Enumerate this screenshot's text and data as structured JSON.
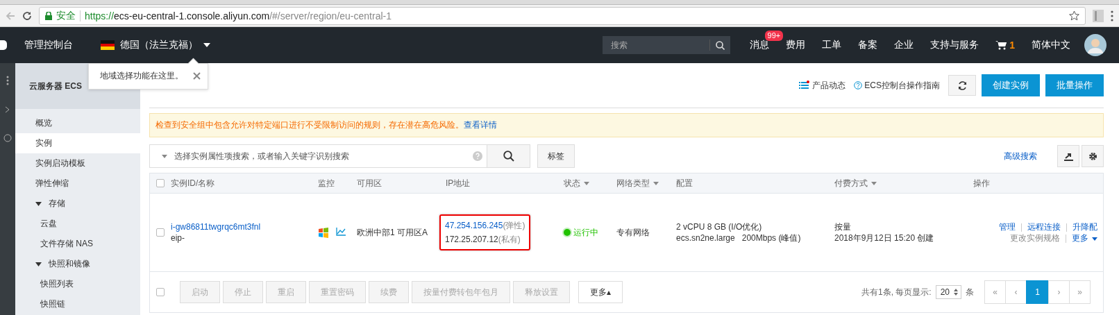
{
  "browser": {
    "secure_label": "安全",
    "url_scheme": "https://",
    "url_host": "ecs-eu-central-1.console.aliyun.com",
    "url_path": "/#/server/region/eu-central-1"
  },
  "topbar": {
    "console": "管理控制台",
    "region": "德国（法兰克福）",
    "search_placeholder": "搜索",
    "nav": [
      {
        "label": "消息",
        "badge": "99+"
      },
      {
        "label": "费用"
      },
      {
        "label": "工单"
      },
      {
        "label": "备案"
      },
      {
        "label": "企业"
      },
      {
        "label": "支持与服务"
      }
    ],
    "cart_count": "1",
    "language": "简体中文"
  },
  "tooltip": {
    "text": "地域选择功能在这里。"
  },
  "sidebar": {
    "title": "云服务器 ECS",
    "items": [
      {
        "label": "概览",
        "selected": false
      },
      {
        "label": "实例",
        "selected": true
      },
      {
        "label": "实例启动模板",
        "selected": false
      },
      {
        "label": "弹性伸缩",
        "selected": false
      },
      {
        "label": "存储",
        "selected": false,
        "expanded": true,
        "children": [
          {
            "label": "云盘",
            "selected": false
          },
          {
            "label": "文件存储 NAS",
            "selected": false
          }
        ]
      },
      {
        "label": "快照和镜像",
        "selected": false,
        "expanded": true,
        "children": [
          {
            "label": "快照列表",
            "selected": false
          },
          {
            "label": "快照链",
            "selected": false
          }
        ]
      }
    ]
  },
  "header_links": [
    {
      "kind": "news",
      "label": "产品动态",
      "unread": true
    },
    {
      "kind": "help",
      "label": "ECS控制台操作指南"
    }
  ],
  "header_buttons": [
    "创建实例",
    "批量操作"
  ],
  "alert": {
    "text": "检查到安全组中包含允许对特定端口进行不受限制访问的规则，存在潜在高危风险。",
    "link": "查看详情"
  },
  "filter": {
    "placeholder": "选择实例属性项搜索，或者输入关键字识别搜索",
    "tag_button": "标签",
    "advanced_search": "高级搜索"
  },
  "table": {
    "checked": false,
    "columns": [
      {
        "label": "实例ID/名称",
        "sortable": false
      },
      {
        "label": "监控",
        "sortable": false
      },
      {
        "label": "可用区",
        "sortable": false
      },
      {
        "label": "IP地址",
        "sortable": false
      },
      {
        "label": "状态",
        "sortable": true
      },
      {
        "label": "网络类型",
        "sortable": true
      },
      {
        "label": "配置",
        "sortable": false
      },
      {
        "label": "付费方式",
        "sortable": true
      },
      {
        "label": "操作",
        "sortable": false
      }
    ],
    "rows": [
      {
        "checked": false,
        "id": "i-gw86811twgrqc6mt3fnl",
        "name": "eip-",
        "zone": "欧洲中部1 可用区A",
        "ip_public": "47.254.156.245",
        "ip_public_tag": "(弹性)",
        "ip_private": "172.25.207.12",
        "ip_private_tag": "(私有)",
        "ip_highlighted": true,
        "status": "运行中",
        "network": "专有网络",
        "config_lines": [
          "2 vCPU 8 GB (I/O优化)",
          "ecs.sn2ne.large   200Mbps (峰值)"
        ],
        "billing": "按量",
        "created": "2018年9月12日 15:20 创建",
        "actions": [
          {
            "label": "管理",
            "disabled": false
          },
          {
            "label": "远程连接",
            "disabled": false
          },
          {
            "label": "升降配",
            "disabled": false
          },
          {
            "label": "更改实例规格",
            "disabled": true
          },
          {
            "label": "更多",
            "disabled": false
          }
        ]
      }
    ]
  },
  "footer": {
    "checked": false,
    "buttons": [
      {
        "label": "启动",
        "disabled": true
      },
      {
        "label": "停止",
        "disabled": true
      },
      {
        "label": "重启",
        "disabled": true
      },
      {
        "label": "重置密码",
        "disabled": true
      },
      {
        "label": "续费",
        "disabled": true
      },
      {
        "label": "按量付费转包年包月",
        "disabled": true
      },
      {
        "label": "释放设置",
        "disabled": true
      },
      {
        "label": "更多▴",
        "disabled": false
      }
    ],
    "total": "共有1条, 每页显示:",
    "page_size": "20",
    "unit": "条",
    "pages": [
      {
        "label": "«",
        "selected": false
      },
      {
        "label": "‹",
        "selected": false
      },
      {
        "label": "1",
        "selected": true
      },
      {
        "label": "›",
        "selected": false
      },
      {
        "label": "»",
        "selected": false
      }
    ]
  }
}
